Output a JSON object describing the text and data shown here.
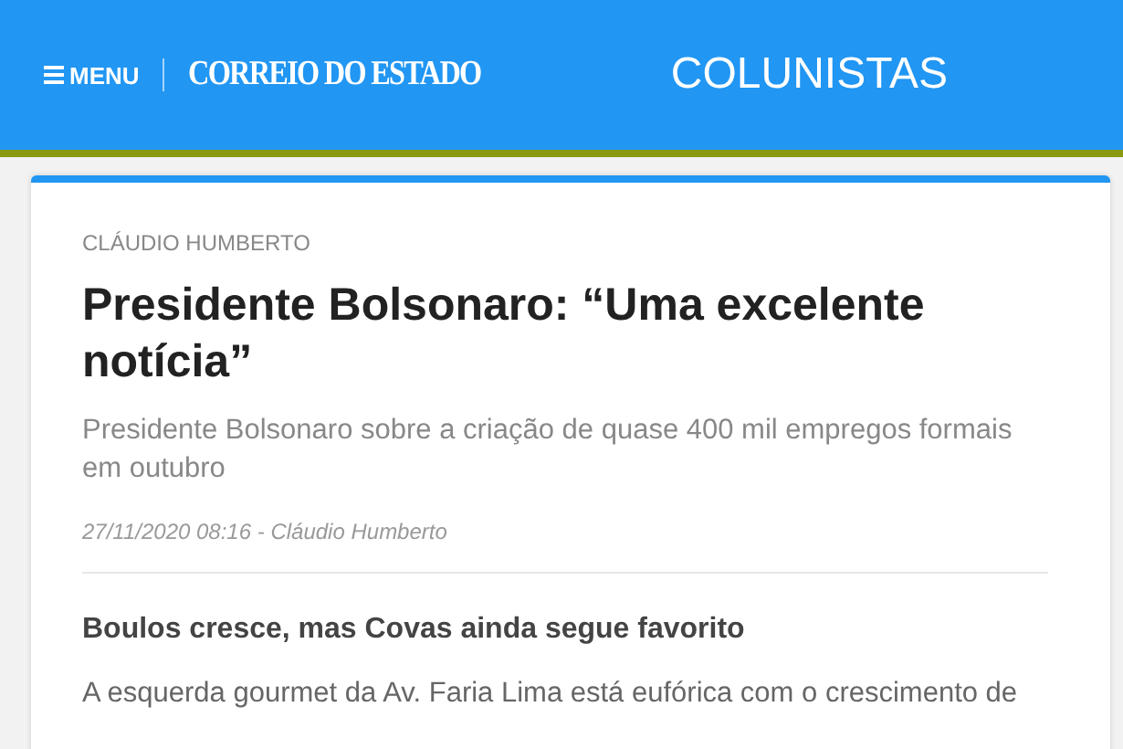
{
  "header": {
    "menu_label": "MENU",
    "logo": "CORREIO DO ESTADO",
    "section": "COLUNISTAS"
  },
  "article": {
    "author": "CLÁUDIO HUMBERTO",
    "title": "Presidente Bolsonaro: “Uma excelente notícia”",
    "subtitle": "Presidente Bolsonaro sobre a criação de quase 400 mil empregos formais em outubro",
    "meta": "27/11/2020 08:16 - Cláudio Humberto",
    "subheading": "Boulos cresce, mas Covas ainda segue favorito",
    "body": "A esquerda gourmet da Av. Faria Lima está eufórica com o crescimento de"
  }
}
